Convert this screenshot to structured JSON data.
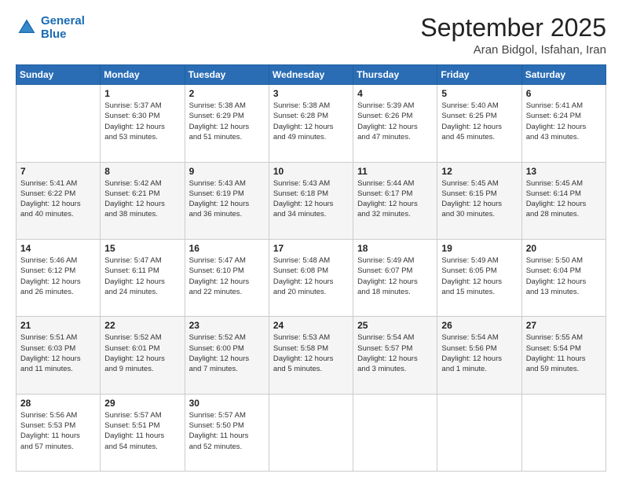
{
  "header": {
    "logo_line1": "General",
    "logo_line2": "Blue",
    "month": "September 2025",
    "location": "Aran Bidgol, Isfahan, Iran"
  },
  "weekdays": [
    "Sunday",
    "Monday",
    "Tuesday",
    "Wednesday",
    "Thursday",
    "Friday",
    "Saturday"
  ],
  "weeks": [
    [
      {
        "day": "",
        "info": ""
      },
      {
        "day": "1",
        "info": "Sunrise: 5:37 AM\nSunset: 6:30 PM\nDaylight: 12 hours\nand 53 minutes."
      },
      {
        "day": "2",
        "info": "Sunrise: 5:38 AM\nSunset: 6:29 PM\nDaylight: 12 hours\nand 51 minutes."
      },
      {
        "day": "3",
        "info": "Sunrise: 5:38 AM\nSunset: 6:28 PM\nDaylight: 12 hours\nand 49 minutes."
      },
      {
        "day": "4",
        "info": "Sunrise: 5:39 AM\nSunset: 6:26 PM\nDaylight: 12 hours\nand 47 minutes."
      },
      {
        "day": "5",
        "info": "Sunrise: 5:40 AM\nSunset: 6:25 PM\nDaylight: 12 hours\nand 45 minutes."
      },
      {
        "day": "6",
        "info": "Sunrise: 5:41 AM\nSunset: 6:24 PM\nDaylight: 12 hours\nand 43 minutes."
      }
    ],
    [
      {
        "day": "7",
        "info": "Sunrise: 5:41 AM\nSunset: 6:22 PM\nDaylight: 12 hours\nand 40 minutes."
      },
      {
        "day": "8",
        "info": "Sunrise: 5:42 AM\nSunset: 6:21 PM\nDaylight: 12 hours\nand 38 minutes."
      },
      {
        "day": "9",
        "info": "Sunrise: 5:43 AM\nSunset: 6:19 PM\nDaylight: 12 hours\nand 36 minutes."
      },
      {
        "day": "10",
        "info": "Sunrise: 5:43 AM\nSunset: 6:18 PM\nDaylight: 12 hours\nand 34 minutes."
      },
      {
        "day": "11",
        "info": "Sunrise: 5:44 AM\nSunset: 6:17 PM\nDaylight: 12 hours\nand 32 minutes."
      },
      {
        "day": "12",
        "info": "Sunrise: 5:45 AM\nSunset: 6:15 PM\nDaylight: 12 hours\nand 30 minutes."
      },
      {
        "day": "13",
        "info": "Sunrise: 5:45 AM\nSunset: 6:14 PM\nDaylight: 12 hours\nand 28 minutes."
      }
    ],
    [
      {
        "day": "14",
        "info": "Sunrise: 5:46 AM\nSunset: 6:12 PM\nDaylight: 12 hours\nand 26 minutes."
      },
      {
        "day": "15",
        "info": "Sunrise: 5:47 AM\nSunset: 6:11 PM\nDaylight: 12 hours\nand 24 minutes."
      },
      {
        "day": "16",
        "info": "Sunrise: 5:47 AM\nSunset: 6:10 PM\nDaylight: 12 hours\nand 22 minutes."
      },
      {
        "day": "17",
        "info": "Sunrise: 5:48 AM\nSunset: 6:08 PM\nDaylight: 12 hours\nand 20 minutes."
      },
      {
        "day": "18",
        "info": "Sunrise: 5:49 AM\nSunset: 6:07 PM\nDaylight: 12 hours\nand 18 minutes."
      },
      {
        "day": "19",
        "info": "Sunrise: 5:49 AM\nSunset: 6:05 PM\nDaylight: 12 hours\nand 15 minutes."
      },
      {
        "day": "20",
        "info": "Sunrise: 5:50 AM\nSunset: 6:04 PM\nDaylight: 12 hours\nand 13 minutes."
      }
    ],
    [
      {
        "day": "21",
        "info": "Sunrise: 5:51 AM\nSunset: 6:03 PM\nDaylight: 12 hours\nand 11 minutes."
      },
      {
        "day": "22",
        "info": "Sunrise: 5:52 AM\nSunset: 6:01 PM\nDaylight: 12 hours\nand 9 minutes."
      },
      {
        "day": "23",
        "info": "Sunrise: 5:52 AM\nSunset: 6:00 PM\nDaylight: 12 hours\nand 7 minutes."
      },
      {
        "day": "24",
        "info": "Sunrise: 5:53 AM\nSunset: 5:58 PM\nDaylight: 12 hours\nand 5 minutes."
      },
      {
        "day": "25",
        "info": "Sunrise: 5:54 AM\nSunset: 5:57 PM\nDaylight: 12 hours\nand 3 minutes."
      },
      {
        "day": "26",
        "info": "Sunrise: 5:54 AM\nSunset: 5:56 PM\nDaylight: 12 hours\nand 1 minute."
      },
      {
        "day": "27",
        "info": "Sunrise: 5:55 AM\nSunset: 5:54 PM\nDaylight: 11 hours\nand 59 minutes."
      }
    ],
    [
      {
        "day": "28",
        "info": "Sunrise: 5:56 AM\nSunset: 5:53 PM\nDaylight: 11 hours\nand 57 minutes."
      },
      {
        "day": "29",
        "info": "Sunrise: 5:57 AM\nSunset: 5:51 PM\nDaylight: 11 hours\nand 54 minutes."
      },
      {
        "day": "30",
        "info": "Sunrise: 5:57 AM\nSunset: 5:50 PM\nDaylight: 11 hours\nand 52 minutes."
      },
      {
        "day": "",
        "info": ""
      },
      {
        "day": "",
        "info": ""
      },
      {
        "day": "",
        "info": ""
      },
      {
        "day": "",
        "info": ""
      }
    ]
  ]
}
